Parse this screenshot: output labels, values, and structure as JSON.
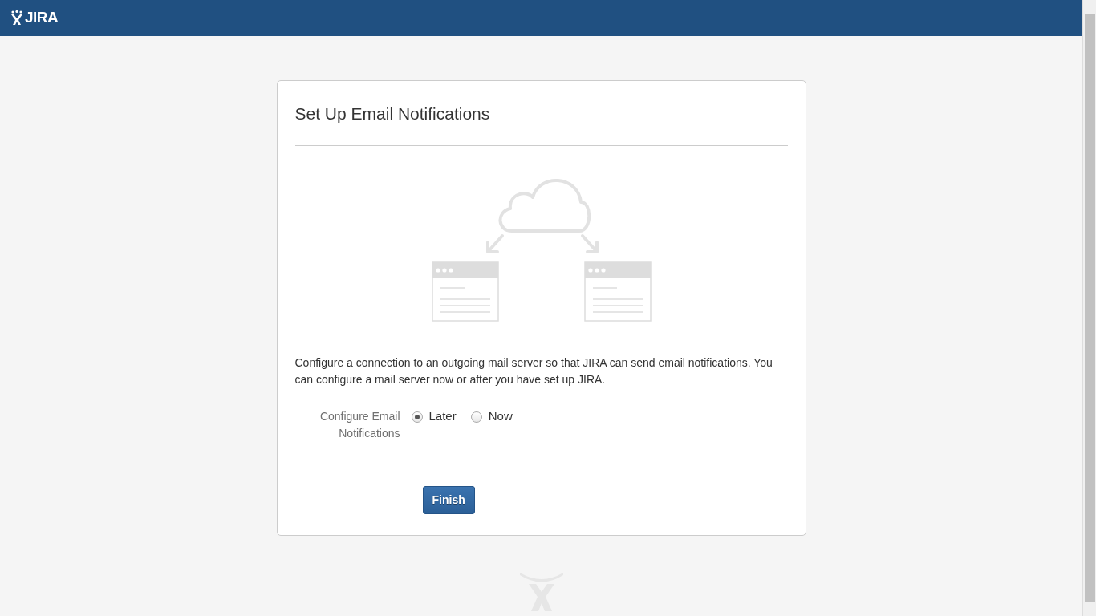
{
  "header": {
    "logo_text": "JIRA"
  },
  "dialog": {
    "title": "Set Up Email Notifications",
    "description": "Configure a connection to an outgoing mail server so that JIRA can send email notifications. You can configure a mail server now or after you have set up JIRA.",
    "field_label": "Configure Email Notifications",
    "options": [
      {
        "label": "Later",
        "selected": true
      },
      {
        "label": "Now",
        "selected": false
      }
    ],
    "button": "Finish"
  }
}
